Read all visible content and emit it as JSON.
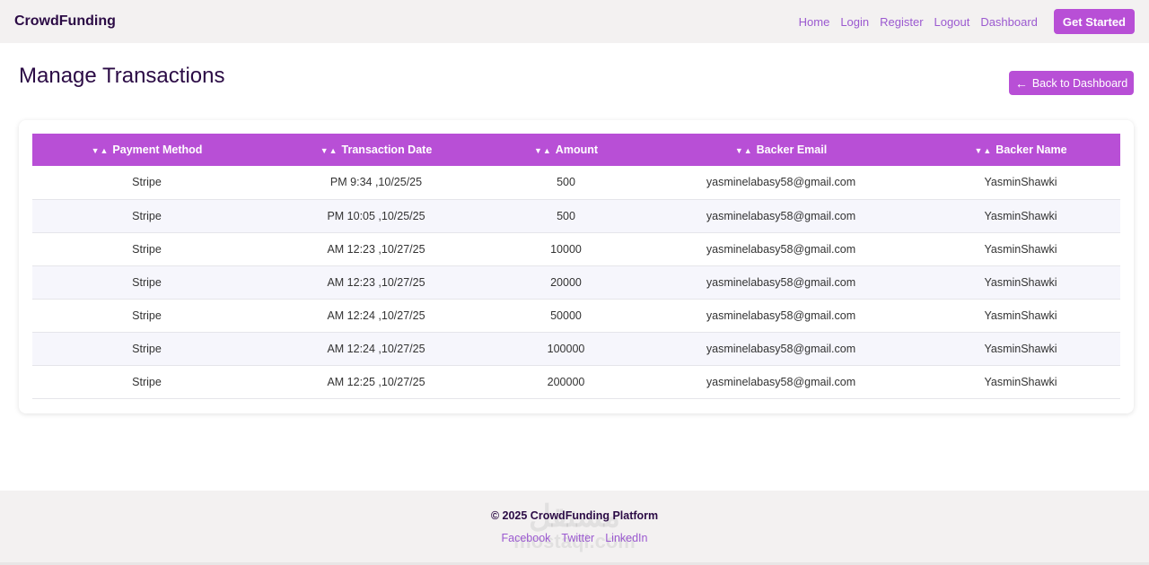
{
  "navbar": {
    "brand": "CrowdFunding",
    "links": [
      "Home",
      "Login",
      "Register",
      "Logout",
      "Dashboard"
    ],
    "cta": "Get Started"
  },
  "page": {
    "title": "Manage Transactions",
    "back_button": "Back to Dashboard",
    "back_icon": "arrow-left-icon"
  },
  "table": {
    "columns": [
      "Payment Method",
      "Transaction Date",
      "Amount",
      "Backer Email",
      "Backer Name"
    ],
    "rows": [
      [
        "Stripe",
        "PM 9:34 ,10/25/25",
        "500",
        "yasminelabasy58@gmail.com",
        "YasminShawki"
      ],
      [
        "Stripe",
        "PM 10:05 ,10/25/25",
        "500",
        "yasminelabasy58@gmail.com",
        "YasminShawki"
      ],
      [
        "Stripe",
        "AM 12:23 ,10/27/25",
        "10000",
        "yasminelabasy58@gmail.com",
        "YasminShawki"
      ],
      [
        "Stripe",
        "AM 12:23 ,10/27/25",
        "20000",
        "yasminelabasy58@gmail.com",
        "YasminShawki"
      ],
      [
        "Stripe",
        "AM 12:24 ,10/27/25",
        "50000",
        "yasminelabasy58@gmail.com",
        "YasminShawki"
      ],
      [
        "Stripe",
        "AM 12:24 ,10/27/25",
        "100000",
        "yasminelabasy58@gmail.com",
        "YasminShawki"
      ],
      [
        "Stripe",
        "AM 12:25 ,10/27/25",
        "200000",
        "yasminelabasy58@gmail.com",
        "YasminShawki"
      ]
    ]
  },
  "footer": {
    "copyright": "© 2025 CrowdFunding Platform",
    "links": [
      "Facebook",
      "Twitter",
      "LinkedIn"
    ],
    "watermark": [
      "مستقل",
      "mostaql.com"
    ]
  },
  "colors": {
    "accent": "#b84fd6",
    "brand_text": "#2b0b45",
    "link": "#9b59d0"
  }
}
